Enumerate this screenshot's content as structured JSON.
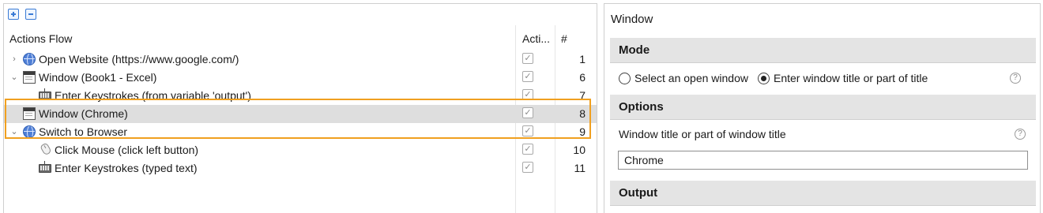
{
  "left": {
    "header": {
      "name": "Actions Flow",
      "active": "Acti...",
      "num": "#"
    },
    "rows": [
      {
        "chev": "›",
        "icon": "globe-icon",
        "label": "Open Website (https://www.google.com/)",
        "num": "1"
      },
      {
        "chev": "⌄",
        "icon": "window-icon",
        "label": "Window (Book1 - Excel)",
        "num": "6"
      },
      {
        "chev": "",
        "icon": "keyboard-icon",
        "label": "Enter Keystrokes (from variable 'output')",
        "num": "7"
      },
      {
        "chev": "",
        "icon": "window-icon",
        "label": "Window (Chrome)",
        "num": "8"
      },
      {
        "chev": "⌄",
        "icon": "globe-icon",
        "label": "Switch to Browser",
        "num": "9"
      },
      {
        "chev": "",
        "icon": "mouse-icon",
        "label": "Click Mouse (click left button)",
        "num": "10"
      },
      {
        "chev": "",
        "icon": "keyboard-icon",
        "label": "Enter Keystrokes (typed text)",
        "num": "11"
      }
    ],
    "check_glyph": "✓"
  },
  "right": {
    "title": "Window",
    "mode_header": "Mode",
    "radio_select": "Select an open window",
    "radio_enter": "Enter window title or part of title",
    "help_glyph": "?",
    "options_header": "Options",
    "field_label": "Window title or part of window title",
    "field_value": "Chrome",
    "output_header": "Output"
  },
  "colors": {
    "highlight": "#f0a020",
    "selected_row": "#dedede",
    "section_bg": "#e4e4e4"
  }
}
